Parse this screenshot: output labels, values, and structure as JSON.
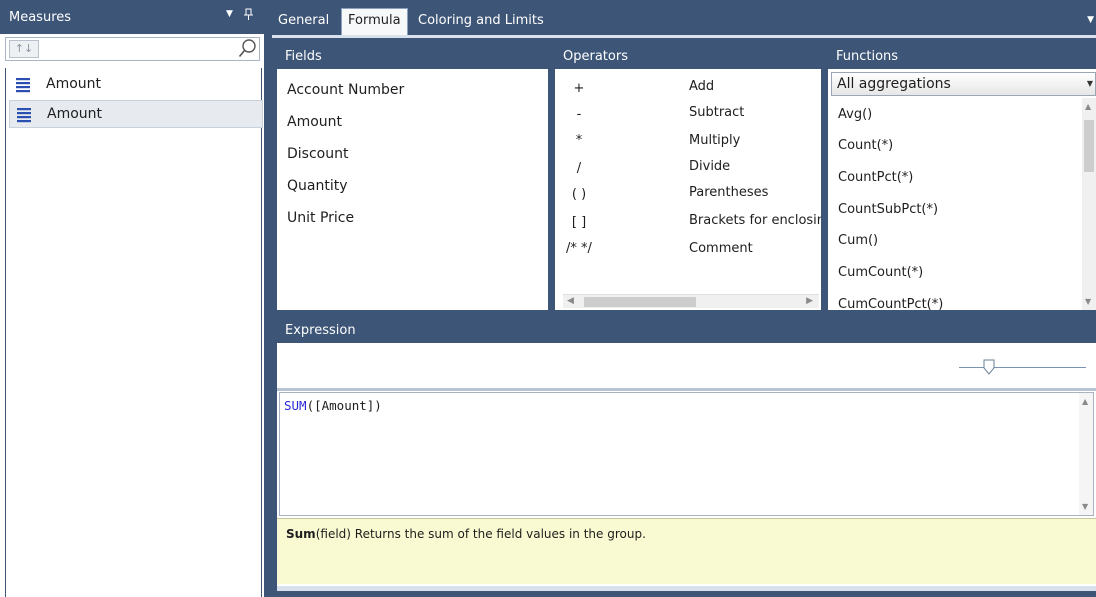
{
  "measures_panel": {
    "title": "Measures",
    "sort_button": "↑↓",
    "search_value": "",
    "items": [
      {
        "label": "Amount",
        "selected": false
      },
      {
        "label": "Amount",
        "selected": true
      }
    ]
  },
  "tabs": [
    {
      "label": "General",
      "active": false
    },
    {
      "label": "Formula",
      "active": true
    },
    {
      "label": "Coloring and Limits",
      "active": false
    }
  ],
  "fields": {
    "title": "Fields",
    "items": [
      "Account Number",
      "Amount",
      "Discount",
      "Quantity",
      "Unit Price"
    ]
  },
  "operators": {
    "title": "Operators",
    "items": [
      {
        "symbol": "+",
        "name": "Add"
      },
      {
        "symbol": "-",
        "name": "Subtract"
      },
      {
        "symbol": "*",
        "name": "Multiply"
      },
      {
        "symbol": "/",
        "name": "Divide"
      },
      {
        "symbol": "( )",
        "name": "Parentheses"
      },
      {
        "symbol": "[ ]",
        "name": "Brackets for enclosing"
      },
      {
        "symbol": "/* */",
        "name": "Comment"
      }
    ]
  },
  "functions": {
    "title": "Functions",
    "category": "All aggregations",
    "items": [
      "Avg()",
      "Count(*)",
      "CountPct(*)",
      "CountSubPct(*)",
      "Cum()",
      "CumCount(*)",
      "CumCountPct(*)"
    ]
  },
  "expression": {
    "title": "Expression",
    "keyword": "SUM",
    "argument": "([Amount])",
    "help_name": "Sum",
    "help_text": "(field) Returns the sum of the field values in the group."
  },
  "colors": {
    "header": "#3d5577",
    "keyword": "#2b2bd6",
    "help_background": "#fafad2"
  }
}
